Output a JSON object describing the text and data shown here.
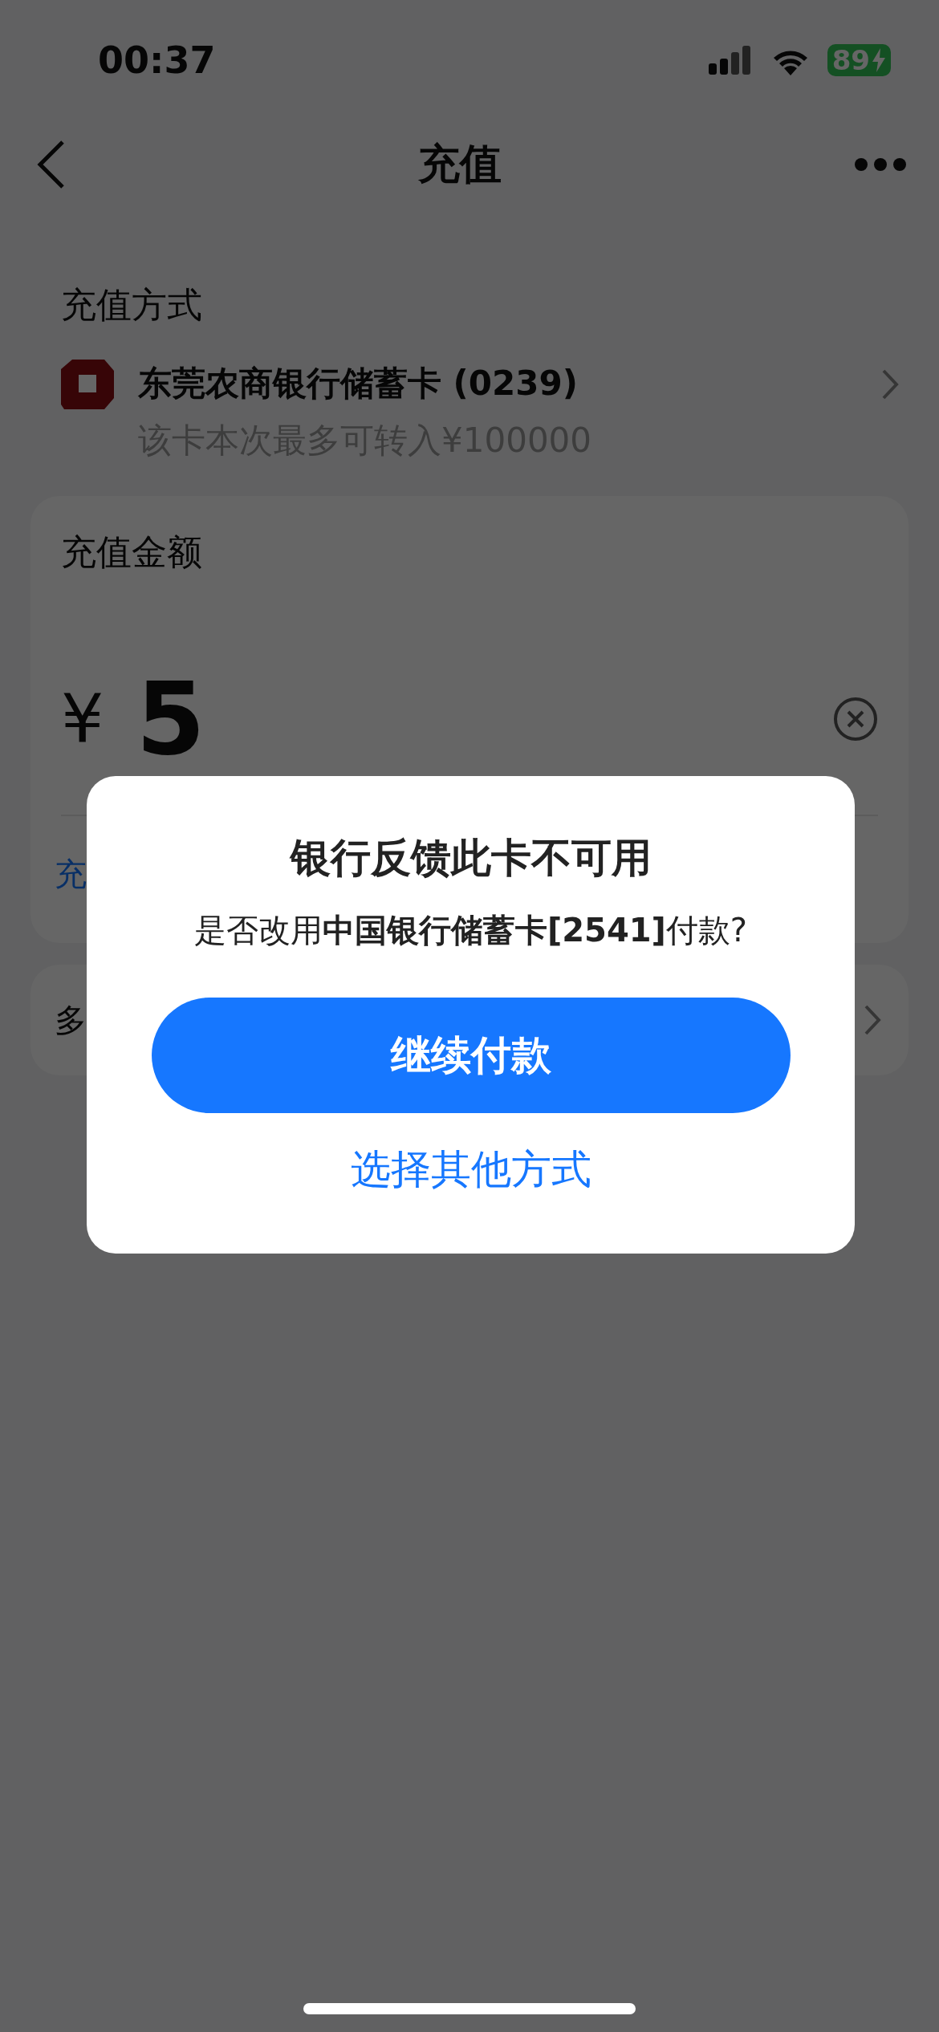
{
  "status_bar": {
    "time": "00:37",
    "battery": "89",
    "charging": true
  },
  "nav": {
    "title": "充值"
  },
  "payment_method": {
    "label": "充值方式",
    "bank": "东莞农商银行储蓄卡 (0239)",
    "limit": "该卡本次最多可转入¥100000"
  },
  "amount_card": {
    "label": "充值金额",
    "currency": "¥",
    "amount": "5",
    "hint": "充"
  },
  "option_row": {
    "label": "多"
  },
  "dialog": {
    "title": "银行反馈此卡不可用",
    "message": "是否改用**中国银行储蓄卡[2541]**付款?",
    "primary_button": "继续付款",
    "secondary_link": "选择其他方式"
  }
}
